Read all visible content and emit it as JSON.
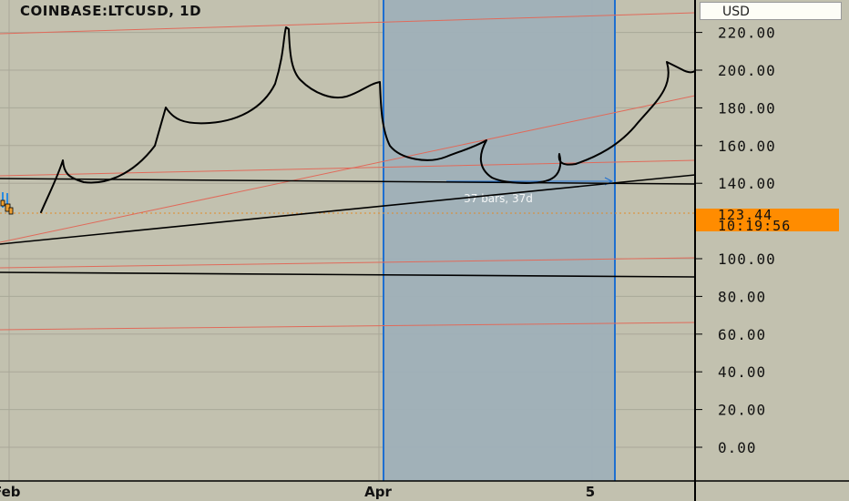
{
  "header": {
    "title": "COINBASE:LTCUSD, 1D",
    "currency_label": "USD"
  },
  "price_badge": {
    "price": "123.44",
    "countdown": "10:19:56"
  },
  "colors": {
    "background": "#c2c1af",
    "selection_fill": "#9fb0b8",
    "selection_border": "#1e6fd0",
    "red_line": "#e06a5a",
    "ink": "#000000",
    "badge": "#ff8c00"
  },
  "chart_data": {
    "type": "line",
    "title": "COINBASE:LTCUSD, 1D",
    "y_axis": {
      "side": "right",
      "ticks": [
        220,
        200,
        180,
        160,
        140,
        100,
        80,
        60,
        40,
        20,
        0
      ],
      "tick_labels": [
        "220.00",
        "200.00",
        "180.00",
        "160.00",
        "140.00",
        "100.00",
        "80.00",
        "60.00",
        "40.00",
        "20.00",
        "0.00"
      ],
      "range": [
        -20,
        230
      ]
    },
    "x_axis": {
      "tick_labels": [
        {
          "label": "Feb",
          "position": "left edge"
        },
        {
          "label": "Apr",
          "position": "center"
        },
        {
          "label": "5",
          "position": "right"
        }
      ]
    },
    "current_price": 123.44,
    "date_range_measure": {
      "label": "37 bars, 37d",
      "bars": 37,
      "days": 37
    },
    "horizontal_levels": [
      {
        "value": 141,
        "color": "black"
      },
      {
        "value": 95,
        "color": "black"
      }
    ],
    "trend_lines_red": [
      {
        "from": 220,
        "to": 232
      },
      {
        "from": 142,
        "to": 154
      },
      {
        "from": 98,
        "to": 103
      },
      {
        "from": 64,
        "to": 70
      },
      {
        "from": 110,
        "to": 185
      }
    ],
    "trend_lines_black": [
      {
        "from": 110,
        "to": 142
      }
    ],
    "grid": true,
    "legend": "none"
  }
}
